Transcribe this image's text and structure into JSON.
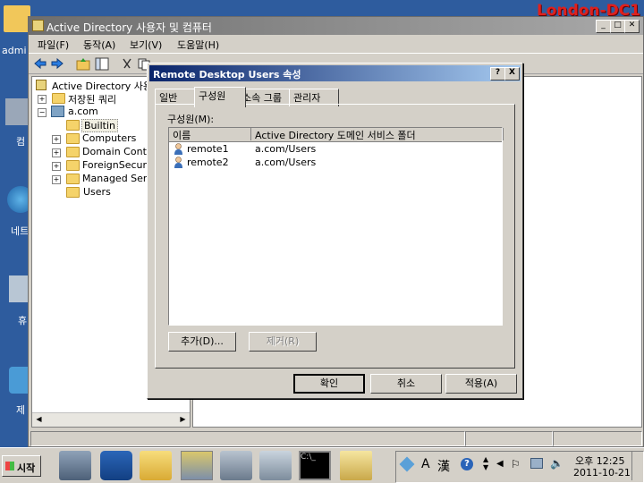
{
  "desktop": {
    "server_label": "London-DC1",
    "icon_labels": [
      "admi",
      "컴",
      "네트",
      "휴",
      "제"
    ]
  },
  "mmc": {
    "title": "Active Directory 사용자 및 컴퓨터",
    "menu": [
      "파일(F)",
      "동작(A)",
      "보기(V)",
      "도움말(H)"
    ],
    "tree": {
      "root": "Active Directory 사용자",
      "saved_queries": "저장된 쿼리",
      "domain": "a.com",
      "children": [
        "Builtin",
        "Computers",
        "Domain Contro",
        "ForeignSecurit",
        "Managed Serv",
        "Users"
      ]
    }
  },
  "dialog": {
    "title": "Remote Desktop Users 속성",
    "help_btn": "?",
    "close_btn": "X",
    "tabs": [
      "일반",
      "구성원",
      "소속 그룹",
      "관리자"
    ],
    "active_tab": "구성원",
    "members_label": "구성원(M):",
    "columns": [
      "이름",
      "Active Directory 도메인 서비스 폴더"
    ],
    "members": [
      {
        "name": "remote1",
        "folder": "a.com/Users"
      },
      {
        "name": "remote2",
        "folder": "a.com/Users"
      }
    ],
    "add_button": "추가(D)...",
    "remove_button": "제거(R)",
    "ok_button": "확인",
    "cancel_button": "취소",
    "apply_button": "적용(A)"
  },
  "taskbar": {
    "start_label": "시작",
    "tray_lang": "A",
    "tray_hanja": "漢",
    "time": "오후 12:25",
    "date": "2011-10-21"
  }
}
